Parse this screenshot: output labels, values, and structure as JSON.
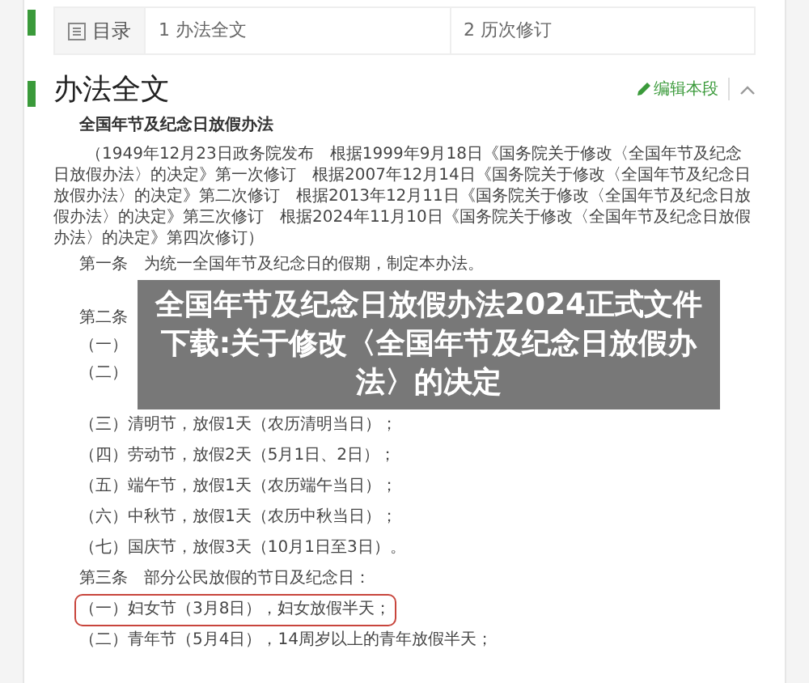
{
  "toc": {
    "label": "目录",
    "items": [
      {
        "number": "1",
        "title": "办法全文"
      },
      {
        "number": "2",
        "title": "历次修订"
      }
    ]
  },
  "section": {
    "title": "办法全文",
    "edit_link": "编辑本段",
    "expanded": true
  },
  "document": {
    "title": "全国年节及纪念日放假办法",
    "preamble": "（1949年12月23日政务院发布　根据1999年9月18日《国务院关于修改〈全国年节及纪念日放假办法〉的决定》第一次修订　根据2007年12月14日《国务院关于修改〈全国年节及纪念日放假办法〉的决定》第二次修订　根据2013年12月11日《国务院关于修改〈全国年节及纪念日放假办法〉的决定》第三次修订　根据2024年11月10日《国务院关于修改〈全国年节及纪念日放假办法〉的决定》第四次修订）",
    "lines": [
      {
        "text": "第一条　为统一全国年节及纪念日的假期，制定本办法。",
        "covered": false,
        "highlighted": false
      },
      {
        "text": "第二条",
        "covered": true,
        "highlighted": false
      },
      {
        "text": "（一）",
        "covered": true,
        "highlighted": false
      },
      {
        "text": "（二）",
        "covered": true,
        "highlighted": false
      },
      {
        "text": "（三）清明节，放假1天（农历清明当日）；",
        "covered": false,
        "highlighted": false
      },
      {
        "text": "（四）劳动节，放假2天（5月1日、2日）；",
        "covered": false,
        "highlighted": false
      },
      {
        "text": "（五）端午节，放假1天（农历端午当日）；",
        "covered": false,
        "highlighted": false
      },
      {
        "text": "（六）中秋节，放假1天（农历中秋当日）；",
        "covered": false,
        "highlighted": false
      },
      {
        "text": "（七）国庆节，放假3天（10月1日至3日）。",
        "covered": false,
        "highlighted": false
      },
      {
        "text": "第三条　部分公民放假的节日及纪念日：",
        "covered": false,
        "highlighted": false
      },
      {
        "text": "（一）妇女节（3月8日），妇女放假半天；",
        "covered": false,
        "highlighted": true
      },
      {
        "text": "（二）青年节（5月4日），14周岁以上的青年放假半天；",
        "covered": false,
        "highlighted": false
      }
    ]
  },
  "banner": {
    "title": "全国年节及纪念日放假办法2024正式文件下载:关于修改〈全国年节及纪念日放假办法〉的决定"
  }
}
